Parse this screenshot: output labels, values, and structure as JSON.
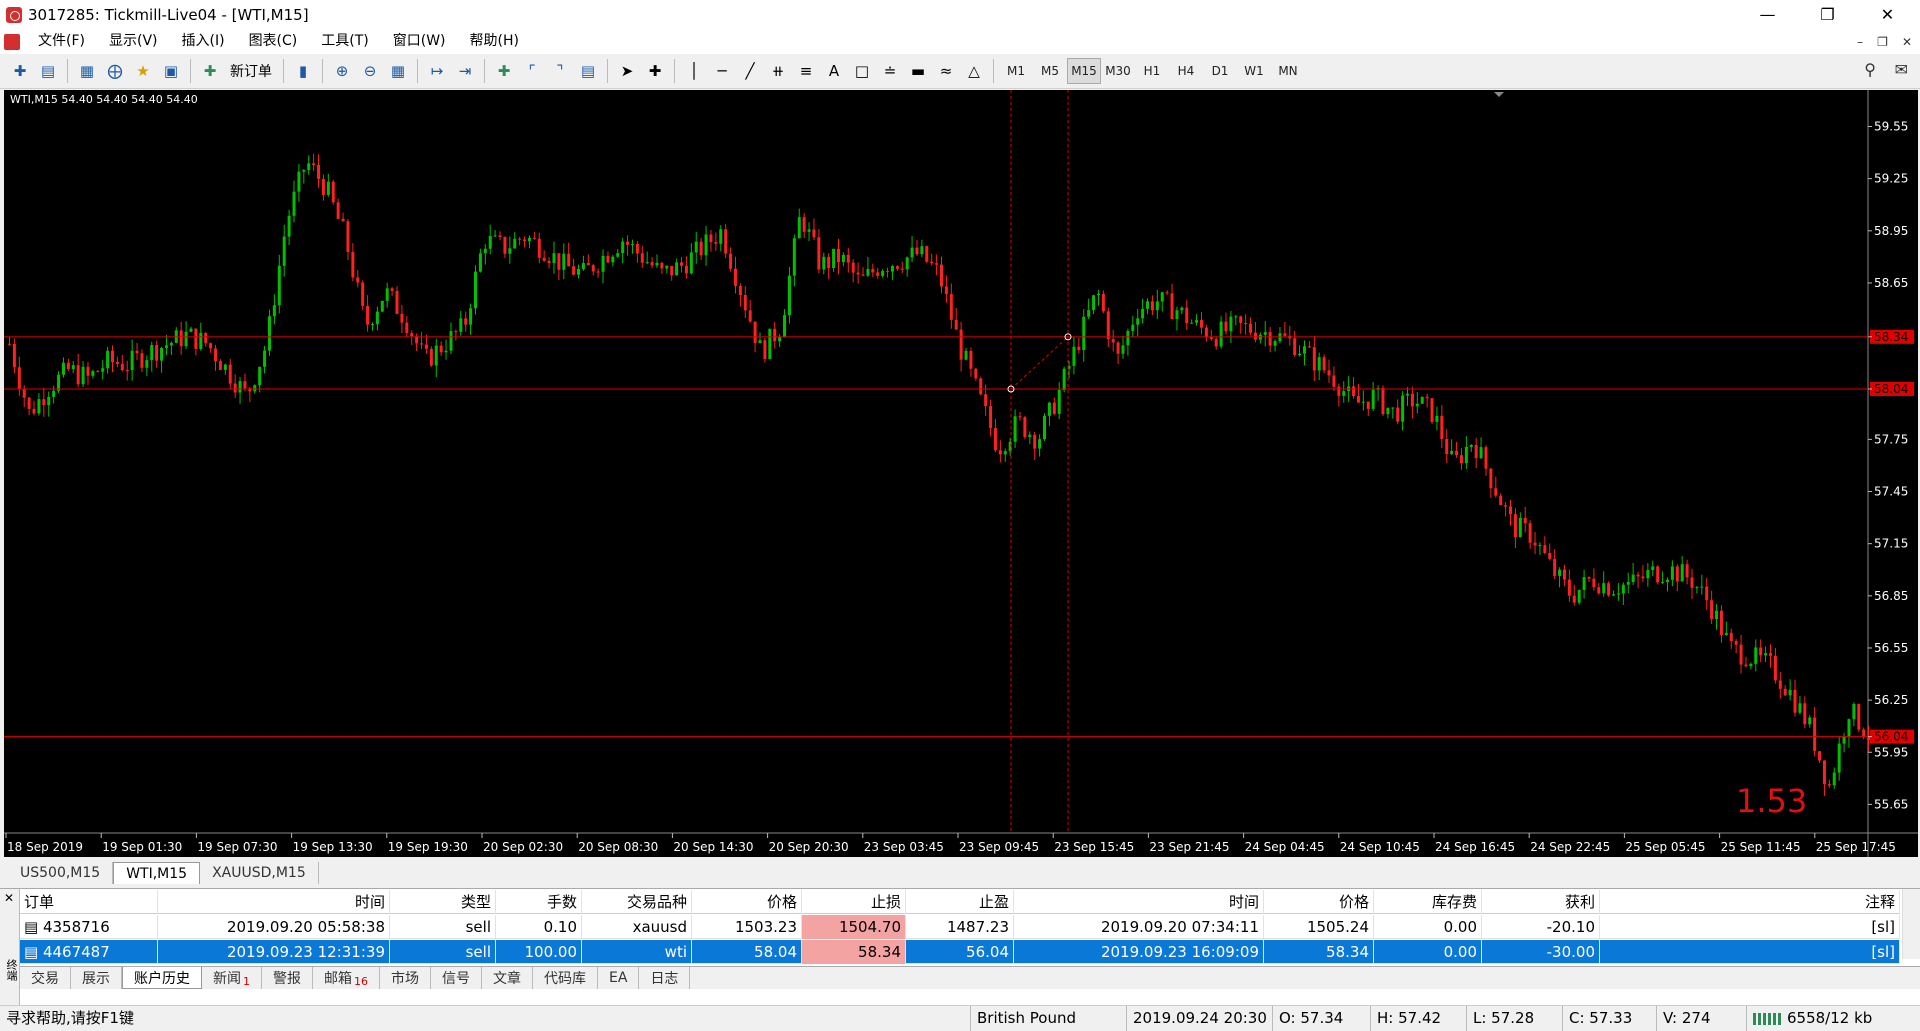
{
  "window": {
    "title": "3017285: Tickmill-Live04 - [WTI,M15]"
  },
  "menu": [
    "文件(F)",
    "显示(V)",
    "插入(I)",
    "图表(C)",
    "工具(T)",
    "窗口(W)",
    "帮助(H)"
  ],
  "toolbar": {
    "new_order_label": "新订单",
    "icons": [
      "new-chart-icon",
      "profiles-icon",
      "market-watch-icon",
      "navigator-icon",
      "favorites-icon",
      "terminal-icon",
      "new-order-icon",
      "autotrading-icon",
      "zoom-in-icon",
      "zoom-out-icon",
      "tile-icon",
      "scroll-icon",
      "shift-icon",
      "indicators-icon",
      "periods-icon",
      "templates-icon",
      "cursor-icon",
      "crosshair-icon",
      "vline-icon",
      "hline-icon",
      "trendline-icon",
      "channel-icon",
      "fibo-icon",
      "text-icon",
      "label-icon",
      "arrows-icon",
      "shapes-icon"
    ],
    "timeframes": [
      "M1",
      "M5",
      "M15",
      "M30",
      "H1",
      "H4",
      "D1",
      "W1",
      "MN"
    ],
    "active_timeframe": "M15",
    "tool_text": "A"
  },
  "chart": {
    "header": "WTI,M15  54.40 54.40 54.40 54.40",
    "price_labels": [
      "59.55",
      "59.25",
      "58.95",
      "58.65",
      "58.34",
      "58.04",
      "57.75",
      "57.45",
      "57.15",
      "56.85",
      "56.55",
      "56.25",
      "56.04",
      "55.95",
      "55.65"
    ],
    "time_labels": [
      "18 Sep 2019",
      "19 Sep 01:30",
      "19 Sep 07:30",
      "19 Sep 13:30",
      "19 Sep 19:30",
      "20 Sep 02:30",
      "20 Sep 08:30",
      "20 Sep 14:30",
      "20 Sep 20:30",
      "23 Sep 03:45",
      "23 Sep 09:45",
      "23 Sep 15:45",
      "23 Sep 21:45",
      "24 Sep 04:45",
      "24 Sep 10:45",
      "24 Sep 16:45",
      "24 Sep 22:45",
      "25 Sep 05:45",
      "25 Sep 11:45",
      "25 Sep 17:45"
    ],
    "hlines": [
      58.34,
      58.04,
      56.04
    ],
    "watermark": "1.53",
    "colors": {
      "bull": "#00c000",
      "bear": "#ff2020",
      "line": "#e00000",
      "bg": "#000000"
    },
    "close_path": [
      58.3,
      57.9,
      58.05,
      58.15,
      58.1,
      58.2,
      58.18,
      58.25,
      58.3,
      58.35,
      58.3,
      58.15,
      58.0,
      58.3,
      59.0,
      59.35,
      59.2,
      58.9,
      58.4,
      58.6,
      58.45,
      58.2,
      58.3,
      58.4,
      58.9,
      58.85,
      58.92,
      58.85,
      58.75,
      58.7,
      58.8,
      58.9,
      58.8,
      58.7,
      58.75,
      58.85,
      58.95,
      58.6,
      58.25,
      58.4,
      59.05,
      58.75,
      58.8,
      58.65,
      58.75,
      58.78,
      58.82,
      58.7,
      58.3,
      58.0,
      57.7,
      57.85,
      57.75,
      58.0,
      58.3,
      58.6,
      58.2,
      58.5,
      58.55,
      58.5,
      58.4,
      58.35,
      58.4,
      58.38,
      58.35,
      58.3,
      58.2,
      58.1,
      57.95,
      58.0,
      57.9,
      57.98,
      57.9,
      57.6,
      57.75,
      57.5,
      57.25,
      57.2,
      57.0,
      56.85,
      56.95,
      56.9,
      56.92,
      56.98,
      57.0,
      56.95,
      56.8,
      56.55,
      56.5,
      56.45,
      56.3,
      56.1,
      55.75,
      56.2,
      56.05
    ]
  },
  "symbol_tabs": [
    "US500,M15",
    "WTI,M15",
    "XAUUSD,M15"
  ],
  "active_symbol_tab": "WTI,M15",
  "terminal": {
    "side_label": "终端",
    "columns": [
      "订单",
      "时间",
      "类型",
      "手数",
      "交易品种",
      "价格",
      "止损",
      "止盈",
      "时间",
      "价格",
      "库存费",
      "获利",
      "注释"
    ],
    "rows": [
      {
        "order": "4358716",
        "open_time": "2019.09.20 05:58:38",
        "type": "sell",
        "lots": "0.10",
        "symbol": "xauusd",
        "price": "1503.23",
        "sl": "1504.70",
        "tp": "1487.23",
        "close_time": "2019.09.20 07:34:11",
        "close_price": "1505.24",
        "swap": "0.00",
        "profit": "-20.10",
        "comment": "[sl]"
      },
      {
        "order": "4467487",
        "open_time": "2019.09.23 12:31:39",
        "type": "sell",
        "lots": "100.00",
        "symbol": "wti",
        "price": "58.04",
        "sl": "58.34",
        "tp": "56.04",
        "close_time": "2019.09.23 16:09:09",
        "close_price": "58.34",
        "swap": "0.00",
        "profit": "-30.00",
        "comment": "[sl]"
      }
    ],
    "tabs": [
      {
        "label": "交易",
        "badge": ""
      },
      {
        "label": "展示",
        "badge": ""
      },
      {
        "label": "账户历史",
        "badge": ""
      },
      {
        "label": "新闻",
        "badge": "1"
      },
      {
        "label": "警报",
        "badge": ""
      },
      {
        "label": "邮箱",
        "badge": "16"
      },
      {
        "label": "市场",
        "badge": ""
      },
      {
        "label": "信号",
        "badge": ""
      },
      {
        "label": "文章",
        "badge": ""
      },
      {
        "label": "代码库",
        "badge": ""
      },
      {
        "label": "EA",
        "badge": ""
      },
      {
        "label": "日志",
        "badge": ""
      }
    ],
    "active_tab": "账户历史"
  },
  "status": {
    "help": "寻求帮助,请按F1键",
    "profile": "British Pound",
    "datetime": "2019.09.24 20:30",
    "open": "O: 57.34",
    "high": "H: 57.42",
    "low": "L: 57.28",
    "close": "C: 57.33",
    "volume": "V: 274",
    "traffic": "6558/12 kb"
  }
}
